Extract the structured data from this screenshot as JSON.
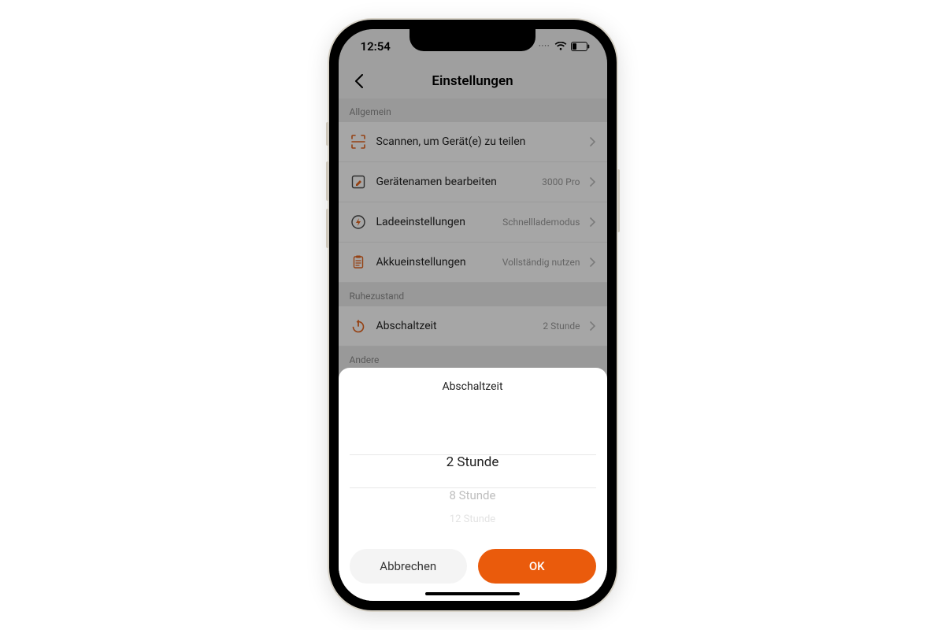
{
  "status": {
    "time": "12:54",
    "dots": "····"
  },
  "header": {
    "title": "Einstellungen"
  },
  "sections": {
    "general_label": "Allgemein",
    "sleep_label": "Ruhezustand",
    "other_label": "Andere"
  },
  "rows": {
    "scan": {
      "label": "Scannen, um Gerät(e) zu teilen",
      "value": ""
    },
    "rename": {
      "label": "Gerätenamen bearbeiten",
      "value": "3000 Pro"
    },
    "charging": {
      "label": "Ladeeinstellungen",
      "value": "Schnelllademodus"
    },
    "battery": {
      "label": "Akkueinstellungen",
      "value": "Vollständig nutzen"
    },
    "shutdown": {
      "label": "Abschaltzeit",
      "value": "2 Stunde"
    }
  },
  "sheet": {
    "title": "Abschaltzeit",
    "options": {
      "selected": "2 Stunde",
      "next1": "8 Stunde",
      "next2": "12 Stunde"
    },
    "cancel": "Abbrechen",
    "ok": "OK"
  },
  "colors": {
    "accent": "#ea5b0c"
  }
}
